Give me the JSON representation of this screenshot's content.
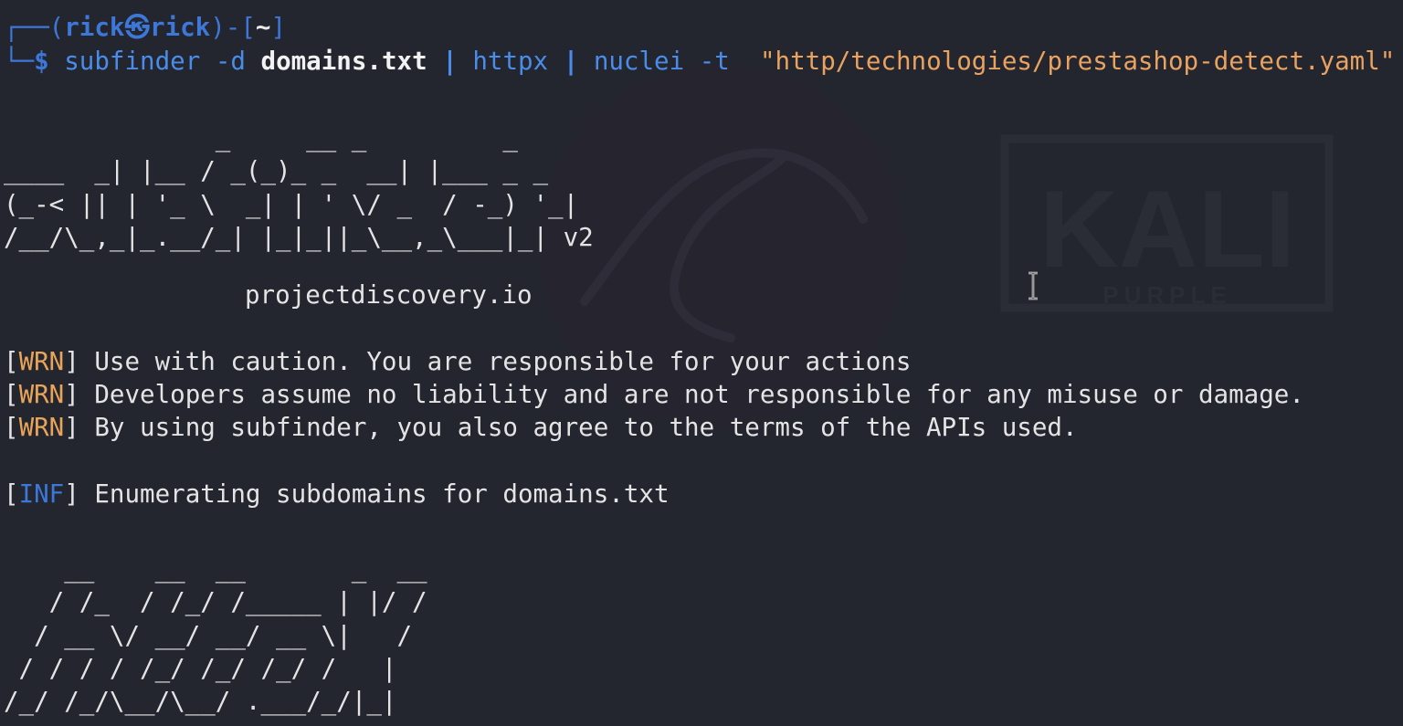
{
  "prompt": {
    "bracket_open": "┌──(",
    "user": "rick",
    "separator": "㉿",
    "host": "rick",
    "bracket_mid": ")-[",
    "cwd": "~",
    "bracket_close": "]",
    "second_prefix": "└─",
    "dollar": "$"
  },
  "command": {
    "tool1": "subfinder",
    "flag1": "-d",
    "file": "domains.txt",
    "pipe1": "|",
    "tool2": "httpx",
    "pipe2": "|",
    "tool3": "nuclei",
    "flag2": "-t",
    "template": "\"http/technologies/prestashop-detect.yaml\""
  },
  "subfinder_banner": {
    "line1": "              _     __ _         _",
    "line2": "____  _| |__ / _(_)_ _  __| |___ _ _",
    "line3": "(_-< || | '_ \\  _| | ' \\/ _  / -_) '_|",
    "line4": "/__/\\_,_|_.__/_| |_|_||_\\__,_\\___|_| v2",
    "site": "projectdiscovery.io"
  },
  "messages": [
    {
      "tag": "WRN",
      "text": "Use with caution. You are responsible for your actions"
    },
    {
      "tag": "WRN",
      "text": "Developers assume no liability and are not responsible for any misuse or damage."
    },
    {
      "tag": "WRN",
      "text": "By using subfinder, you also agree to the terms of the APIs used."
    },
    {
      "tag": "INF",
      "text": "Enumerating subdomains for domains.txt"
    }
  ],
  "httpx_banner": {
    "line1": "    __    __  __       _  __",
    "line2": "   / /_  / /_/ /_____ | |/ /",
    "line3": "  / __ \\/ __/ __/ __ \\|   /",
    "line4": " / / / / /_/ /_/ /_/ /   |",
    "line5": "/_/ /_/\\__/\\__/ .___/_/|_|"
  },
  "wallpaper": {
    "brand": "KALI",
    "edition": "PURPLE"
  },
  "colors": {
    "background": "#23252f",
    "prompt": "#3d78d8",
    "warning": "#e8a55a",
    "string": "#e9a25f"
  }
}
